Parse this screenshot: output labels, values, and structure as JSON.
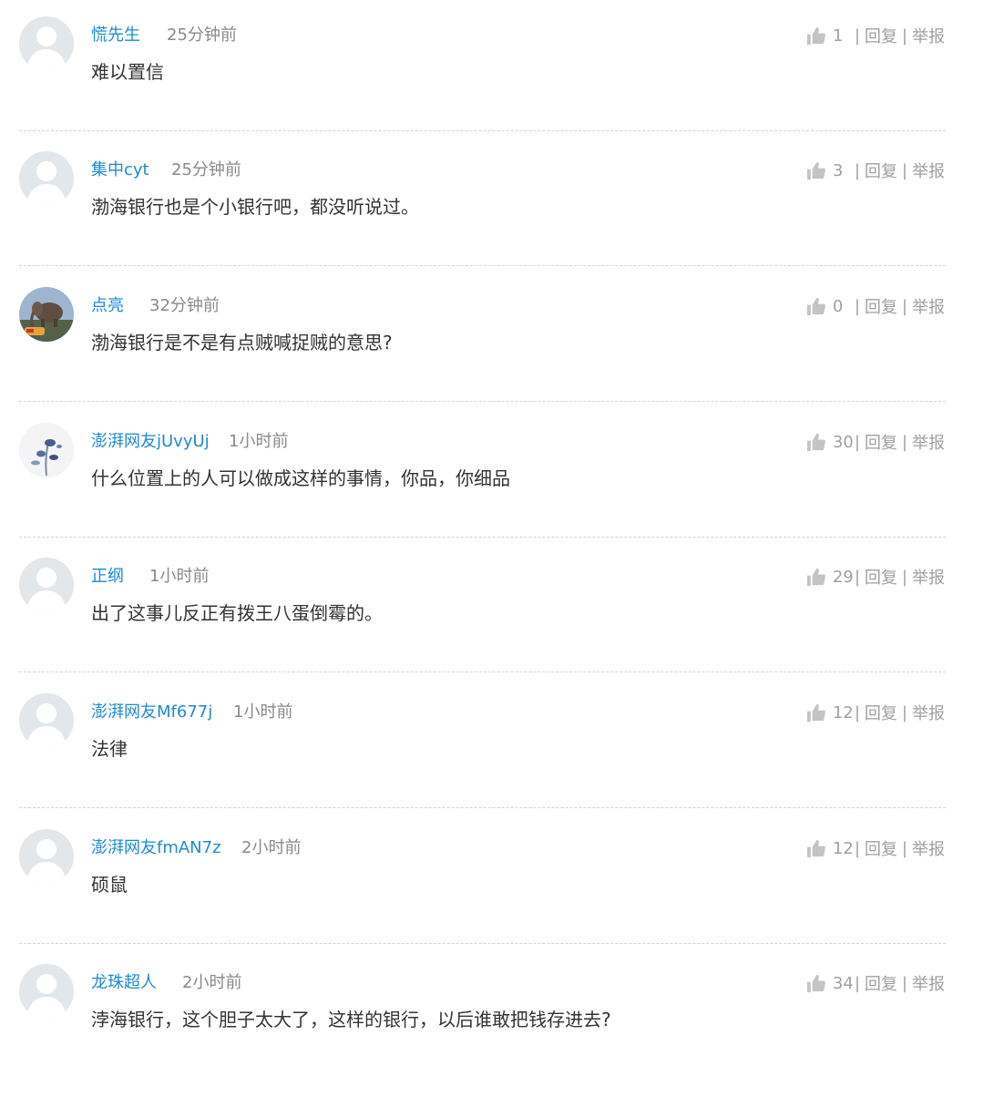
{
  "comments": [
    {
      "user": "慌先生",
      "time": "25分钟前",
      "content": "难以置信",
      "likes": "1",
      "reply": "回复",
      "report": "举报",
      "avatar": "default"
    },
    {
      "user": "集中cyt",
      "time": "25分钟前",
      "content": "渤海银行也是个小银行吧，都没听说过。",
      "likes": "3",
      "reply": "回复",
      "report": "举报",
      "avatar": "default"
    },
    {
      "user": "点亮",
      "time": "32分钟前",
      "content": "渤海银行是不是有点贼喊捉贼的意思?",
      "likes": "0",
      "reply": "回复",
      "report": "举报",
      "avatar": "photo-elephant"
    },
    {
      "user": "澎湃网友jUvyUj",
      "time": "1小时前",
      "content": "什么位置上的人可以做成这样的事情，你品，你细品",
      "likes": "30",
      "reply": "回复",
      "report": "举报",
      "avatar": "photo-flowers"
    },
    {
      "user": "正纲",
      "time": "1小时前",
      "content": "出了这事儿反正有拨王八蛋倒霉的。",
      "likes": "29",
      "reply": "回复",
      "report": "举报",
      "avatar": "default"
    },
    {
      "user": "澎湃网友Mf677j",
      "time": "1小时前",
      "content": "法律",
      "likes": "12",
      "reply": "回复",
      "report": "举报",
      "avatar": "default"
    },
    {
      "user": "澎湃网友fmAN7z",
      "time": "2小时前",
      "content": "硕鼠",
      "likes": "12",
      "reply": "回复",
      "report": "举报",
      "avatar": "default"
    },
    {
      "user": "龙珠超人",
      "time": "2小时前",
      "content": "浡海银行，这个胆子太大了，这样的银行，以后谁敢把钱存进去?",
      "likes": "34",
      "reply": "回复",
      "report": "举报",
      "avatar": "default"
    }
  ],
  "colors": {
    "username": "#1e8ad2",
    "time": "#8a8a8a",
    "content": "#333333",
    "action": "#a0a0a0",
    "divider": "#d4d4d4",
    "avatar_bg": "#e3e7ea"
  },
  "icons": {
    "like": "thumbs-up-icon",
    "avatar_default": "user-silhouette-icon"
  }
}
